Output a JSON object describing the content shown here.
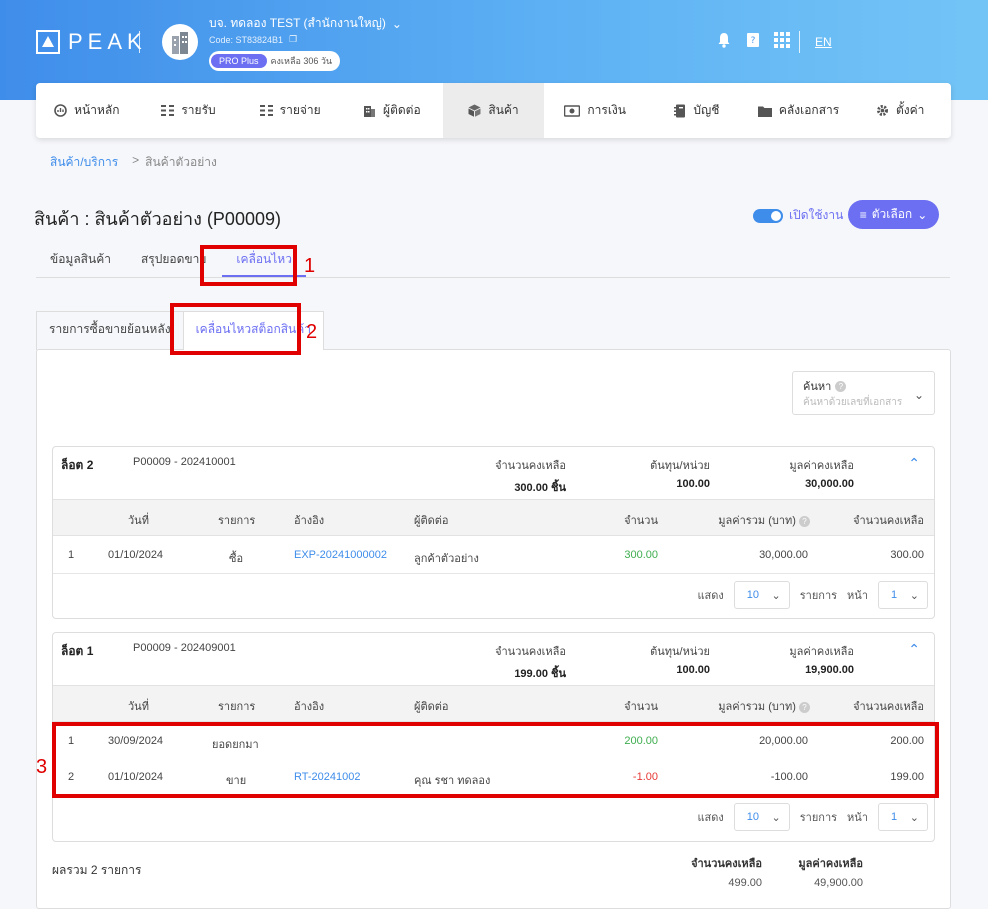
{
  "header": {
    "logo_text": "PEAK",
    "company_name": "บจ. ทดลอง TEST (สำนักงานใหญ่)",
    "company_code": "Code: ST83824B1",
    "plan": "PRO Plus",
    "plan_remaining": "คงเหลือ 306 วัน",
    "language": "EN",
    "icons": [
      "bell-icon",
      "book-icon",
      "apps-grid-icon"
    ]
  },
  "menu": [
    {
      "label": "หน้าหลัก",
      "icon": "dashboard-icon"
    },
    {
      "label": "รายรับ",
      "icon": "income-icon"
    },
    {
      "label": "รายจ่าย",
      "icon": "expense-icon"
    },
    {
      "label": "ผู้ติดต่อ",
      "icon": "contacts-icon"
    },
    {
      "label": "สินค้า",
      "icon": "box-icon",
      "active": true
    },
    {
      "label": "การเงิน",
      "icon": "money-icon"
    },
    {
      "label": "บัญชี",
      "icon": "ledger-icon"
    },
    {
      "label": "คลังเอกสาร",
      "icon": "folder-icon"
    },
    {
      "label": "ตั้งค่า",
      "icon": "gear-icon"
    }
  ],
  "breadcrumb": {
    "root": "สินค้า/บริการ",
    "separator": ">",
    "current": "สินค้าตัวอย่าง"
  },
  "page": {
    "title": "สินค้า : สินค้าตัวอย่าง (P00009)",
    "toggle_label": "เปิดใช้งาน",
    "options_label": "ตัวเลือก"
  },
  "tabs": [
    "ข้อมูลสินค้า",
    "สรุปยอดขาย",
    "เคลื่อนไหว"
  ],
  "subtabs": [
    "รายการซื้อขายย้อนหลัง",
    "เคลื่อนไหวสต็อกสินค้า"
  ],
  "annotations": [
    "1",
    "2",
    "3"
  ],
  "search": {
    "label": "ค้นหา",
    "placeholder": "ค้นหาด้วยเลขที่เอกสาร"
  },
  "columns": [
    "วันที่",
    "รายการ",
    "อ้างอิง",
    "ผู้ติดต่อ",
    "จำนวน",
    "มูลค่ารวม (บาท)",
    "จำนวนคงเหลือ"
  ],
  "summary_labels": {
    "remaining_qty": "จำนวนคงเหลือ",
    "cost_per_unit": "ต้นทุน/หน่วย",
    "remaining_value": "มูลค่าคงเหลือ"
  },
  "pager_labels": {
    "show": "แสดง",
    "items": "รายการ",
    "page": "หน้า",
    "per_page": "10",
    "page_no": "1"
  },
  "lots": [
    {
      "name": "ล็อต 2",
      "code": "P00009 - 202410001",
      "remaining_qty": "300.00 ชิ้น",
      "cost_per_unit": "100.00",
      "remaining_value": "30,000.00",
      "rows": [
        {
          "no": "1",
          "date": "01/10/2024",
          "type": "ซื้อ",
          "ref": "EXP-20241000002",
          "contact": "ลูกค้าตัวอย่าง",
          "qty": "300.00",
          "total": "30,000.00",
          "balance": "300.00"
        }
      ]
    },
    {
      "name": "ล็อต 1",
      "code": "P00009 - 202409001",
      "remaining_qty": "199.00 ชิ้น",
      "cost_per_unit": "100.00",
      "remaining_value": "19,900.00",
      "rows": [
        {
          "no": "1",
          "date": "30/09/2024",
          "type": "ยอดยกมา",
          "ref": "",
          "contact": "",
          "qty": "200.00",
          "total": "20,000.00",
          "balance": "200.00"
        },
        {
          "no": "2",
          "date": "01/10/2024",
          "type": "ขาย",
          "ref": "RT-20241002",
          "contact": "คุณ รชา ทดลอง",
          "qty": "-1.00",
          "total": "-100.00",
          "balance": "199.00"
        }
      ]
    }
  ],
  "totals": {
    "label": "ผลรวม 2 รายการ",
    "qty_header": "จำนวนคงเหลือ",
    "value_header": "มูลค่าคงเหลือ",
    "qty": "499.00",
    "value": "49,900.00"
  }
}
